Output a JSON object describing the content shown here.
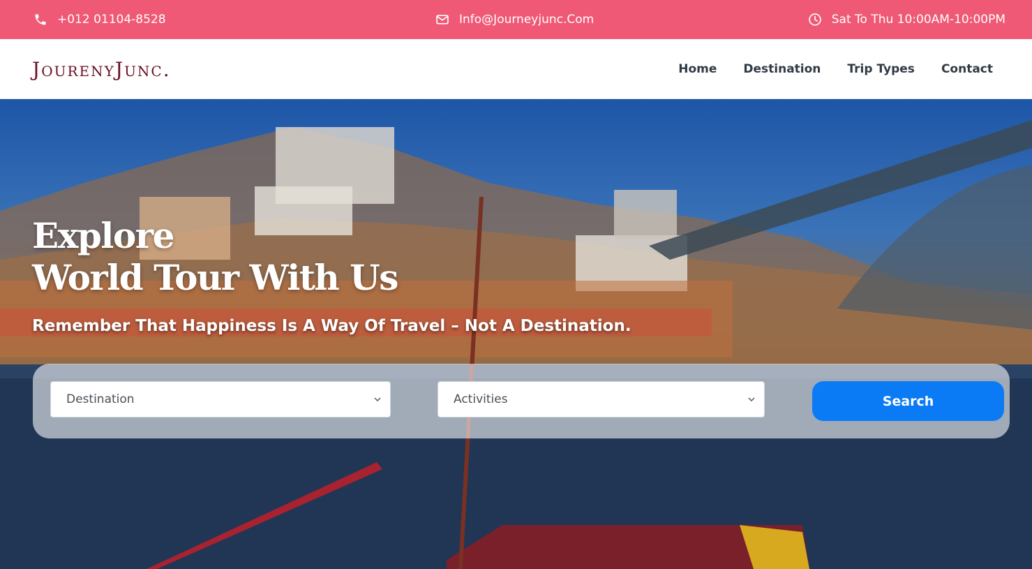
{
  "topbar": {
    "phone": "+012 01104-8528",
    "email": "Info@Journeyjunc.Com",
    "hours": "Sat To Thu 10:00AM-10:00PM",
    "icons": [
      "phone-icon",
      "envelope-icon",
      "clock-icon"
    ],
    "background": "#ef5975"
  },
  "navbar": {
    "logo": "JourenyJunc.",
    "items": [
      "Home",
      "Destination",
      "Trip Types",
      "Contact"
    ]
  },
  "hero": {
    "title_line1": "Explore",
    "title_line2": "World Tour With Us",
    "subtitle": "Remember That Happiness Is A Way Of Travel – Not A Destination."
  },
  "search": {
    "destination_value": "Destination",
    "activities_value": "Activities",
    "button_label": "Search",
    "button_color": "#0b7bf5"
  }
}
